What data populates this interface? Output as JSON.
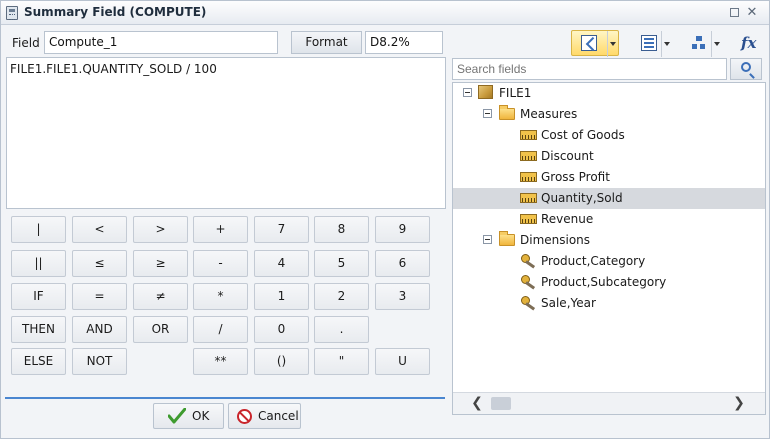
{
  "window": {
    "title": "Summary Field (COMPUTE)"
  },
  "field": {
    "label": "Field",
    "value": "Compute_1"
  },
  "format": {
    "button_label": "Format",
    "value": "D8.2%"
  },
  "expression": "FILE1.FILE1.QUANTITY_SOLD / 100",
  "keypad": [
    [
      "|",
      "<",
      ">",
      "+",
      "7",
      "8",
      "9"
    ],
    [
      "||",
      "≤",
      "≥",
      "-",
      "4",
      "5",
      "6"
    ],
    [
      "IF",
      "=",
      "≠",
      "*",
      "1",
      "2",
      "3"
    ],
    [
      "THEN",
      "AND",
      "OR",
      "/",
      "0",
      ".",
      ""
    ],
    [
      "ELSE",
      "NOT",
      "",
      "**",
      "()",
      "\"",
      "U"
    ]
  ],
  "actions": {
    "ok_label": "OK",
    "cancel_label": "Cancel"
  },
  "search": {
    "placeholder": "Search fields"
  },
  "tree": {
    "root": "FILE1",
    "measures_label": "Measures",
    "measures": [
      "Cost of Goods",
      "Discount",
      "Gross Profit",
      "Quantity,Sold",
      "Revenue"
    ],
    "selected_measure_index": 3,
    "dimensions_label": "Dimensions",
    "dimensions": [
      "Product,Category",
      "Product,Subcategory",
      "Sale,Year"
    ]
  },
  "colors": {
    "accent": "#4a86d0",
    "selected_row": "#d6d9de",
    "active_tool": "#ffd96a"
  }
}
